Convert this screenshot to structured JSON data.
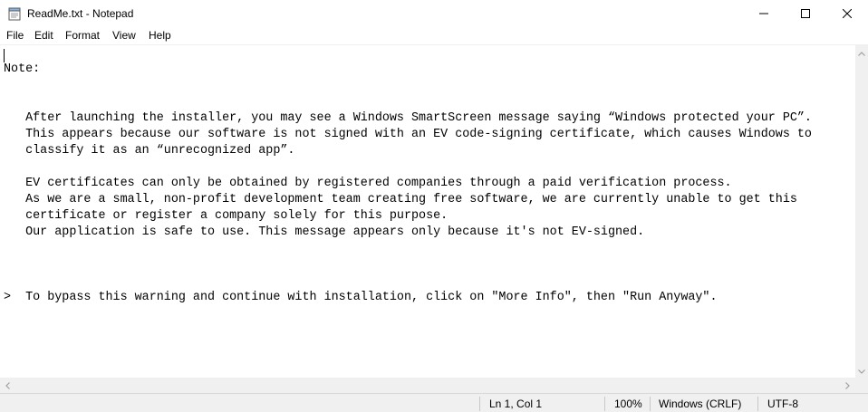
{
  "window": {
    "title": "ReadMe.txt - Notepad",
    "icon": "notepad-icon"
  },
  "titlebar_buttons": {
    "minimize_icon": "minimize-icon",
    "maximize_icon": "maximize-icon",
    "close_icon": "close-icon"
  },
  "menu": {
    "file": "File",
    "edit": "Edit",
    "format": "Format",
    "view": "View",
    "help": "Help"
  },
  "document": {
    "text": "Note:\n\n\n   After launching the installer, you may see a Windows SmartScreen message saying “Windows protected your PC”.\n   This appears because our software is not signed with an EV code-signing certificate, which causes Windows to\n   classify it as an “unrecognized app”.\n\n   EV certificates can only be obtained by registered companies through a paid verification process.\n   As we are a small, non-profit development team creating free software, we are currently unable to get this\n   certificate or register a company solely for this purpose.\n   Our application is safe to use. This message appears only because it's not EV-signed.\n\n\n\n>  To bypass this warning and continue with installation, click on \"More Info\", then \"Run Anyway\"."
  },
  "status": {
    "position": "Ln 1, Col 1",
    "zoom": "100%",
    "line_endings": "Windows (CRLF)",
    "encoding": "UTF-8"
  },
  "colors": {
    "background": "#ffffff",
    "chrome": "#f0f0f0",
    "text": "#000000"
  }
}
